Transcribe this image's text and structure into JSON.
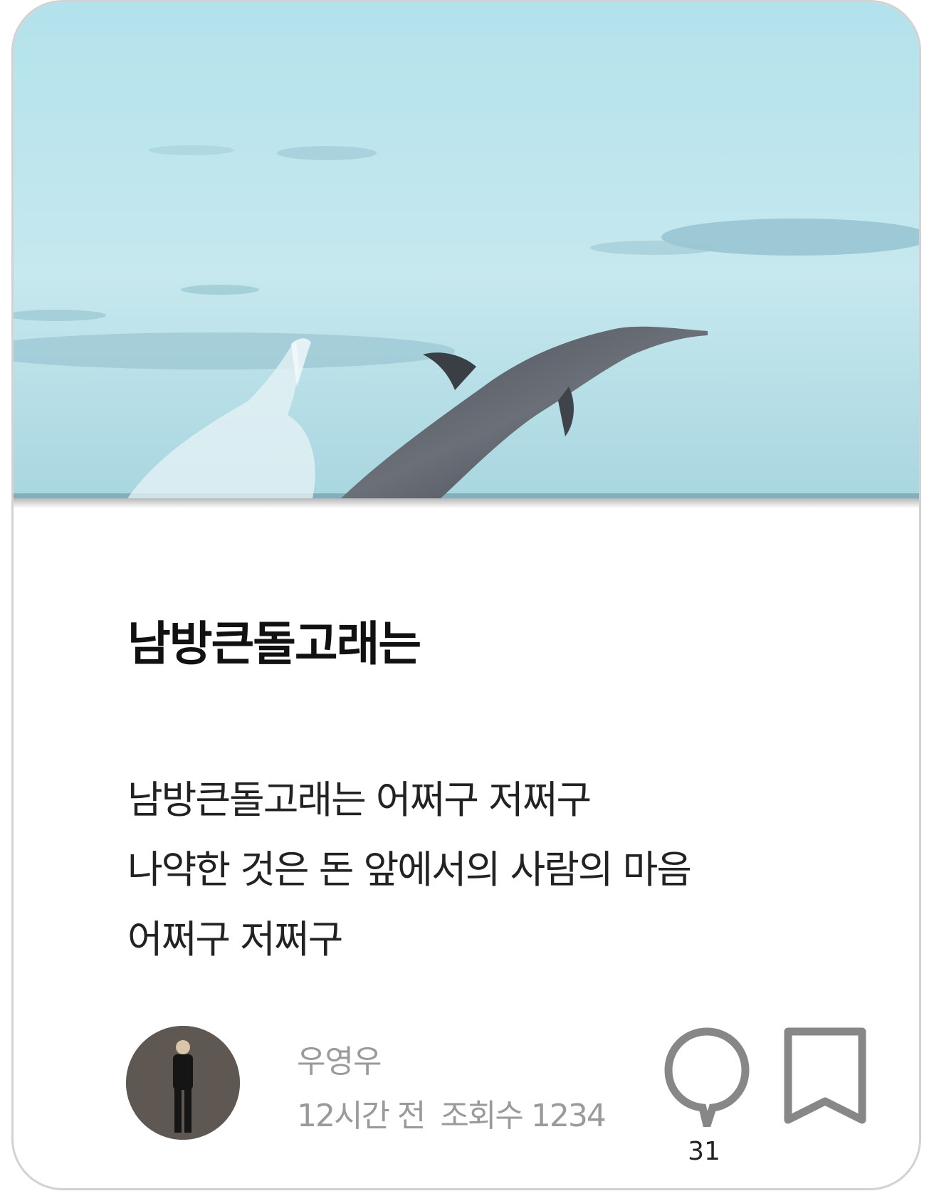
{
  "post": {
    "image_alt": "dolphin-jumping-over-sea",
    "title": "남방큰돌고래는",
    "body_lines": [
      "남방큰돌고래는 어쩌구 저쩌구",
      "나약한 것은 돈 앞에서의 사람의 마음",
      "어쩌구 저쩌구"
    ],
    "author": "우영우",
    "time": "12시간 전",
    "views": "조회수 1234",
    "comment_count": "31"
  },
  "icons": {
    "comment": "speech-bubble-icon",
    "bookmark": "bookmark-icon"
  },
  "colors": {
    "icon_gray": "#878787",
    "meta_gray": "#9a9a9a",
    "border": "#d2d2d2"
  }
}
